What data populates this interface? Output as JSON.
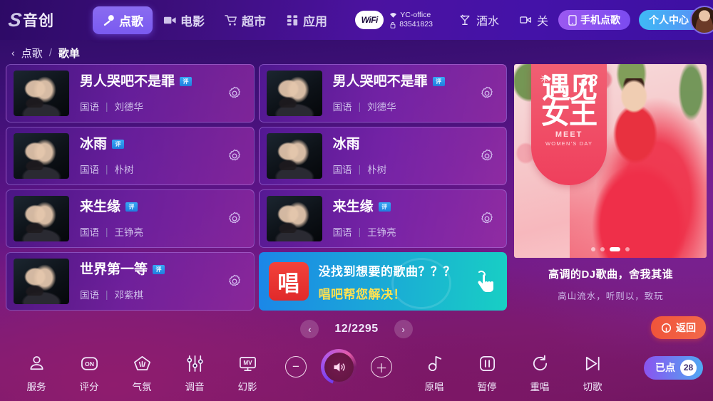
{
  "topnav": {
    "logo_mark": "S",
    "logo_text": "音创",
    "items": [
      {
        "label": "点歌",
        "icon": "mic-icon",
        "active": true
      },
      {
        "label": "电影",
        "icon": "movie-icon",
        "active": false
      },
      {
        "label": "超市",
        "icon": "cart-icon",
        "active": false
      },
      {
        "label": "应用",
        "icon": "apps-icon",
        "active": false
      }
    ],
    "wifi": {
      "badge": "WiFi",
      "ssid": "YC-office",
      "password": "83541823"
    },
    "drinks_label": "酒水",
    "camera_label": "关",
    "phone_order_label": "手机点歌",
    "user_center_label": "个人中心"
  },
  "breadcrumb": {
    "back_chevron": "‹",
    "parent": "点歌",
    "separator": "/",
    "current": "歌单"
  },
  "songs": {
    "left": [
      {
        "title": "男人哭吧不是罪",
        "badge": "评",
        "language": "国语",
        "artist": "刘德华"
      },
      {
        "title": "冰雨",
        "badge": "评",
        "language": "国语",
        "artist": "朴树"
      },
      {
        "title": "来生缘",
        "badge": "评",
        "language": "国语",
        "artist": "王铮亮"
      },
      {
        "title": "世界第一等",
        "badge": "评",
        "language": "国语",
        "artist": "邓紫棋"
      }
    ],
    "right": [
      {
        "title": "男人哭吧不是罪",
        "badge": "评",
        "language": "国语",
        "artist": "刘德华"
      },
      {
        "title": "冰雨",
        "badge": "",
        "language": "国语",
        "artist": "朴树"
      },
      {
        "title": "来生缘",
        "badge": "评",
        "language": "国语",
        "artist": "王铮亮"
      }
    ]
  },
  "promo": {
    "logo": "唱",
    "line1": "没找到想要的歌曲？？？",
    "line2": "唱吧帮您解决！"
  },
  "poster": {
    "star": "✳",
    "number": "38",
    "cn_line1": "遇见",
    "cn_line2": "女王",
    "en_line1": "MEET",
    "en_line2": "WOMEN'S DAY",
    "dots_total": 4,
    "dots_active_index": 2,
    "caption_title": "高调的DJ歌曲，舍我其谁",
    "caption_sub": "高山流水，听则以，致玩"
  },
  "pager": {
    "prev": "‹",
    "next": "›",
    "current_page": 12,
    "total_pages": 2295,
    "display": "12/2295",
    "back_label": "返回"
  },
  "bottom": {
    "left_tools": [
      {
        "label": "服务",
        "icon": "person-icon"
      },
      {
        "label": "评分",
        "icon": "score-on-icon"
      },
      {
        "label": "气氛",
        "icon": "atmosphere-icon"
      },
      {
        "label": "调音",
        "icon": "equalizer-icon"
      },
      {
        "label": "幻影",
        "icon": "mv-screen-icon"
      }
    ],
    "volume": {
      "minus": "−",
      "plus": "＋",
      "speaker_icon": "speaker-icon"
    },
    "right_tools": [
      {
        "label": "原唱",
        "icon": "original-vocal-icon"
      },
      {
        "label": "暂停",
        "icon": "pause-icon"
      },
      {
        "label": "重唱",
        "icon": "repeat-icon"
      },
      {
        "label": "切歌",
        "icon": "next-track-icon"
      }
    ],
    "queue_label": "已点",
    "queue_count": "28"
  },
  "colors": {
    "accent_purple": "#7a5af0",
    "accent_blue": "#3fb9f5",
    "accent_teal": "#18cfc4",
    "accent_orange": "#f0543a",
    "badge_blue": "#1f7ede",
    "promo_yellow": "#ffe14f"
  }
}
